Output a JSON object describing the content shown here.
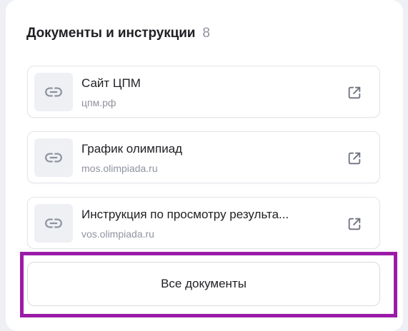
{
  "section": {
    "title": "Документы и инструкции",
    "count": "8"
  },
  "documents": [
    {
      "name": "Сайт ЦПМ",
      "url": "цпм.рф"
    },
    {
      "name": "График олимпиад",
      "url": "mos.olimpiada.ru"
    },
    {
      "name": "Инструкция по просмотру результа...",
      "url": "vos.olimpiada.ru"
    }
  ],
  "all_button": {
    "label": "Все документы"
  },
  "colors": {
    "highlight": "#9b1ba8",
    "muted": "#8f93a0",
    "text": "#1f1f24"
  },
  "icons": {
    "thumb": "link-icon",
    "action": "external-link-icon"
  }
}
